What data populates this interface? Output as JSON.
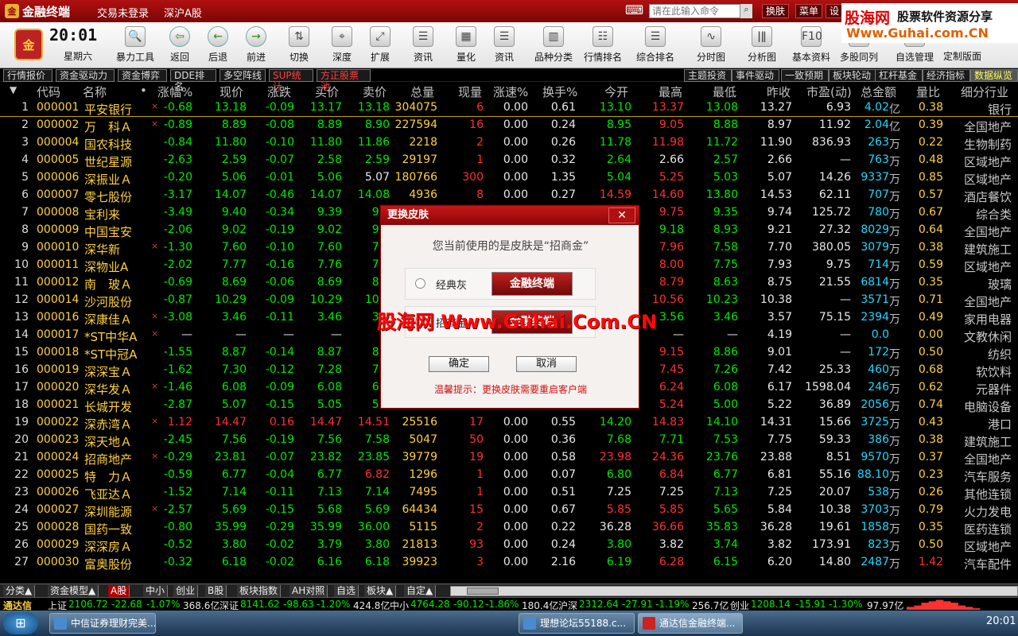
{
  "title": {
    "app": "金融终端",
    "status": "交易未登录",
    "market": "深沪A股",
    "cmd_placeholder": "请在此输入命令",
    "btn_skin": "换肤",
    "btn_menu": "菜单",
    "btn_set": "设"
  },
  "watermark": {
    "top1": "股海网",
    "top2": "股票软件资源分享",
    "top3": "Www.Guhai.com.CN",
    "mid": "股海网 Www.Guhai.Com.CN"
  },
  "clock": {
    "time": "20:01",
    "weekday": "星期六",
    "badge": "金"
  },
  "toolbar": [
    {
      "label": "暴力工具",
      "icon": "magnifier-icon"
    },
    {
      "label": "返回",
      "icon": "back-icon"
    },
    {
      "label": "后退",
      "icon": "left-icon"
    },
    {
      "label": "前进",
      "icon": "right-icon"
    },
    {
      "label": "切换",
      "icon": "switch-icon"
    },
    {
      "label": "深度",
      "icon": "depth-icon"
    },
    {
      "label": "扩展",
      "icon": "expand-icon"
    },
    {
      "label": "资讯",
      "icon": "news-icon"
    },
    {
      "label": "量化",
      "icon": "quant-icon"
    },
    {
      "label": "资讯",
      "icon": "info-icon"
    },
    {
      "label": "品种分类",
      "icon": "category-icon"
    },
    {
      "label": "行情排名",
      "icon": "ranking-icon"
    },
    {
      "label": "综合排名",
      "icon": "list-icon"
    },
    {
      "label": "分时图",
      "icon": "minute-chart-icon"
    },
    {
      "label": "分析图",
      "icon": "kline-icon"
    },
    {
      "label": "基本资料",
      "icon": "f10-icon"
    },
    {
      "label": "多股同列",
      "icon": "multi-stock-icon"
    },
    {
      "label": "自选管理",
      "icon": "favorites-icon"
    },
    {
      "label": "定制版面",
      "icon": "layout-icon"
    }
  ],
  "tabs_left": [
    "行情报价",
    "资金驱动力",
    "资金博弈",
    "DDE排名",
    "多空阵线",
    "SUP统计",
    "方正股票池"
  ],
  "tabs_right": [
    "主题投资",
    "事件驱动",
    "一致预期",
    "板块轮动",
    "杠杆基金",
    "经济指标",
    "数据纵览"
  ],
  "columns": [
    "代码",
    "名称",
    "•",
    "涨幅%",
    "现价",
    "涨跌",
    "买价",
    "卖价",
    "总量",
    "现量",
    "涨速%",
    "换手%",
    "今开",
    "最高",
    "最低",
    "昨收",
    "市盈(动)",
    "总金额",
    "量比",
    "细分行业"
  ],
  "rows": [
    [
      "1",
      "000001",
      "平安银行",
      "×",
      "-0.68",
      "13.18",
      "-0.09",
      "13.17",
      "13.18",
      "304075",
      "6",
      "0.00",
      "0.61",
      "13.10",
      "13.37",
      "13.08",
      "13.27",
      "6.93",
      "4.02",
      "亿",
      "0.38",
      "银行"
    ],
    [
      "2",
      "000002",
      "万　科Ａ",
      "×",
      "-0.89",
      "8.89",
      "-0.08",
      "8.89",
      "8.90",
      "227594",
      "16",
      "0.00",
      "0.24",
      "8.95",
      "9.05",
      "8.88",
      "8.97",
      "11.92",
      "2.04",
      "亿",
      "0.39",
      "全国地产"
    ],
    [
      "3",
      "000004",
      "国农科技",
      "",
      "-0.84",
      "11.80",
      "-0.10",
      "11.80",
      "11.86",
      "2218",
      "2",
      "0.00",
      "0.26",
      "11.78",
      "11.98",
      "11.72",
      "11.90",
      "836.93",
      "263",
      "万",
      "0.22",
      "生物制药"
    ],
    [
      "4",
      "000005",
      "世纪星源",
      "",
      "-2.63",
      "2.59",
      "-0.07",
      "2.58",
      "2.59",
      "29197",
      "1",
      "0.00",
      "0.32",
      "2.64",
      "2.66",
      "2.57",
      "2.66",
      "—",
      "763",
      "万",
      "0.48",
      "区域地产"
    ],
    [
      "5",
      "000006",
      "深振业Ａ",
      "",
      "-0.20",
      "5.06",
      "-0.01",
      "5.06",
      "5.07",
      "180766",
      "300",
      "0.00",
      "1.35",
      "5.04",
      "5.25",
      "5.03",
      "5.07",
      "14.26",
      "9337",
      "万",
      "0.85",
      "区域地产"
    ],
    [
      "6",
      "000007",
      "零七股份",
      "",
      "-3.17",
      "14.07",
      "-0.46",
      "14.07",
      "14.08",
      "4936",
      "8",
      "0.00",
      "0.27",
      "14.59",
      "14.60",
      "13.80",
      "14.53",
      "62.11",
      "707",
      "万",
      "0.57",
      "酒店餐饮"
    ],
    [
      "7",
      "000008",
      "宝利来",
      "",
      "-3.49",
      "9.40",
      "-0.34",
      "9.39",
      "9.4",
      "",
      "",
      "",
      "",
      "",
      "9.75",
      "9.35",
      "9.74",
      "125.72",
      "780",
      "万",
      "0.67",
      "综合类"
    ],
    [
      "8",
      "000009",
      "中国宝安",
      "",
      "-2.06",
      "9.02",
      "-0.19",
      "9.02",
      "9.0",
      "",
      "",
      "",
      "",
      "",
      "9.18",
      "8.93",
      "9.21",
      "27.32",
      "8029",
      "万",
      "0.64",
      "全国地产"
    ],
    [
      "9",
      "000010",
      "深华新",
      "×",
      "-1.30",
      "7.60",
      "-0.10",
      "7.60",
      "7.6",
      "",
      "",
      "",
      "",
      "",
      "7.96",
      "7.58",
      "7.70",
      "380.05",
      "3079",
      "万",
      "0.38",
      "建筑施工"
    ],
    [
      "10",
      "000011",
      "深物业A",
      "",
      "-2.02",
      "7.77",
      "-0.16",
      "7.76",
      "7.7",
      "",
      "",
      "",
      "",
      "",
      "8.00",
      "7.75",
      "7.93",
      "9.75",
      "714",
      "万",
      "0.59",
      "区域地产"
    ],
    [
      "11",
      "000012",
      "南　玻Ａ",
      "",
      "-0.69",
      "8.69",
      "-0.06",
      "8.69",
      "8.7",
      "",
      "",
      "",
      "",
      "",
      "8.79",
      "8.63",
      "8.75",
      "21.55",
      "6814",
      "万",
      "0.35",
      "玻璃"
    ],
    [
      "12",
      "000014",
      "沙河股份",
      "",
      "-0.87",
      "10.29",
      "-0.09",
      "10.29",
      "10.3",
      "",
      "",
      "",
      "",
      "",
      "10.56",
      "10.23",
      "10.38",
      "—",
      "3571",
      "万",
      "0.71",
      "全国地产"
    ],
    [
      "13",
      "000016",
      "深康佳Ａ",
      "×",
      "-3.08",
      "3.46",
      "-0.11",
      "3.46",
      "3.4",
      "",
      "",
      "",
      "",
      "",
      "3.56",
      "3.46",
      "3.57",
      "75.15",
      "2394",
      "万",
      "0.49",
      "家用电器"
    ],
    [
      "14",
      "000017",
      "*ST中华A",
      "×",
      "—",
      "—",
      "—",
      "—",
      "—",
      "",
      "",
      "",
      "",
      "",
      "—",
      "—",
      "4.19",
      "—",
      "0.0",
      "",
      "0.00",
      "文教休闲"
    ],
    [
      "15",
      "000018",
      "*ST中冠A",
      "",
      "-1.55",
      "8.87",
      "-0.14",
      "8.87",
      "8.8",
      "",
      "",
      "",
      "",
      "",
      "9.15",
      "8.86",
      "9.01",
      "—",
      "172",
      "万",
      "0.50",
      "纺织"
    ],
    [
      "16",
      "000019",
      "深深宝Ａ",
      "",
      "-1.62",
      "7.30",
      "-0.12",
      "7.28",
      "7.3",
      "",
      "",
      "",
      "",
      "",
      "7.45",
      "7.26",
      "7.42",
      "25.33",
      "460",
      "万",
      "0.68",
      "软饮料"
    ],
    [
      "17",
      "000020",
      "深华发Ａ",
      "×",
      "-1.46",
      "6.08",
      "-0.09",
      "6.08",
      "6.1",
      "",
      "",
      "",
      "",
      "",
      "6.24",
      "6.08",
      "6.17",
      "1598.04",
      "246",
      "万",
      "0.62",
      "元器件"
    ],
    [
      "18",
      "000021",
      "长城开发",
      "",
      "-2.87",
      "5.07",
      "-0.15",
      "5.05",
      "5.0",
      "",
      "",
      "",
      "",
      "",
      "5.24",
      "5.00",
      "5.22",
      "36.89",
      "2056",
      "万",
      "0.74",
      "电脑设备"
    ],
    [
      "19",
      "000022",
      "深赤湾Ａ",
      "×",
      "1.12",
      "14.47",
      "0.16",
      "14.47",
      "14.51",
      "25516",
      "17",
      "0.00",
      "0.55",
      "14.20",
      "14.83",
      "14.10",
      "14.31",
      "15.66",
      "3725",
      "万",
      "0.43",
      "港口"
    ],
    [
      "20",
      "000023",
      "深天地Ａ",
      "",
      "-2.45",
      "7.56",
      "-0.19",
      "7.56",
      "7.58",
      "5047",
      "50",
      "0.00",
      "0.36",
      "7.68",
      "7.71",
      "7.53",
      "7.75",
      "59.33",
      "386",
      "万",
      "0.38",
      "建筑施工"
    ],
    [
      "21",
      "000024",
      "招商地产",
      "×",
      "-0.29",
      "23.81",
      "-0.07",
      "23.82",
      "23.85",
      "39779",
      "19",
      "0.00",
      "0.58",
      "23.98",
      "24.36",
      "23.76",
      "23.88",
      "8.51",
      "9570",
      "万",
      "0.37",
      "全国地产"
    ],
    [
      "22",
      "000025",
      "特　力Ａ",
      "",
      "-0.59",
      "6.77",
      "-0.04",
      "6.77",
      "6.82",
      "1296",
      "1",
      "0.00",
      "0.07",
      "6.80",
      "6.84",
      "6.77",
      "6.81",
      "55.16",
      "88.10",
      "万",
      "0.23",
      "汽车服务"
    ],
    [
      "23",
      "000026",
      "飞亚达Ａ",
      "",
      "-1.52",
      "7.14",
      "-0.11",
      "7.13",
      "7.14",
      "7495",
      "1",
      "0.00",
      "0.51",
      "7.25",
      "7.25",
      "7.13",
      "7.25",
      "20.07",
      "538",
      "万",
      "0.26",
      "其他连锁"
    ],
    [
      "24",
      "000027",
      "深圳能源",
      "×",
      "-2.57",
      "5.69",
      "-0.15",
      "5.68",
      "5.69",
      "64434",
      "15",
      "0.00",
      "0.67",
      "5.85",
      "5.85",
      "5.65",
      "5.84",
      "10.38",
      "3703",
      "万",
      "0.79",
      "火力发电"
    ],
    [
      "25",
      "000028",
      "国药一致",
      "",
      "-0.80",
      "35.99",
      "-0.29",
      "35.99",
      "36.00",
      "5115",
      "2",
      "0.00",
      "0.22",
      "36.28",
      "36.66",
      "35.83",
      "36.28",
      "19.61",
      "1858",
      "万",
      "0.35",
      "医药连锁"
    ],
    [
      "26",
      "000029",
      "深深房Ａ",
      "",
      "-0.52",
      "3.80",
      "-0.02",
      "3.79",
      "3.80",
      "21813",
      "93",
      "0.00",
      "0.24",
      "3.80",
      "3.82",
      "3.74",
      "3.82",
      "173.91",
      "823",
      "万",
      "0.50",
      "区域地产"
    ],
    [
      "27",
      "000030",
      "富奥股份",
      "",
      "-0.32",
      "6.18",
      "-0.02",
      "6.16",
      "6.18",
      "39923",
      "3",
      "0.00",
      "2.16",
      "6.19",
      "6.28",
      "6.15",
      "6.20",
      "14.80",
      "2487",
      "万",
      "1.42",
      "汽车配件"
    ]
  ],
  "dialog": {
    "title": "更换皮肤",
    "close": "✕",
    "message": "您当前使用的是皮肤是“招商金”",
    "opt1": "经典灰",
    "opt2": "招商金",
    "skin_logo": "金融终端",
    "ok": "确定",
    "cancel": "取消",
    "tip": "温馨提示：更换皮肤需要重启客户端"
  },
  "bottom_tabs": [
    "分类▲",
    "资金模型▲",
    "A股",
    "中小",
    "创业",
    "B股",
    "板块指数",
    "AH对照",
    "自选",
    "板块▲",
    "自定▲"
  ],
  "ticker": {
    "brand": "通达信",
    "sh_label": "上证",
    "sh_val": "2106.72",
    "sh_chg": "-22.68",
    "sh_pct": "-1.07%",
    "sh_amt": "368.6亿",
    "sz_label": "深证",
    "sz_val": "8141.62",
    "sz_chg": "-98.63",
    "sz_pct": "-1.20%",
    "sz_amt": "424.8亿",
    "zx_label": "中小",
    "zx_val": "4764.28",
    "zx_chg": "-90.12",
    "zx_pct": "-1.86%",
    "zx_amt": "180.4亿",
    "hs_label": "沪深",
    "hs_val": "2312.64",
    "hs_chg": "-27.91",
    "hs_pct": "-1.19%",
    "hs_amt": "256.7亿",
    "cy_label": "创业",
    "cy_val": "1208.14",
    "cy_chg": "-15.91",
    "cy_pct": "-1.30%",
    "cy_amt": "97.97亿"
  },
  "taskbar": {
    "start": "⊞",
    "tasks": [
      "中信证券理财完美...",
      "理想论坛55188.c...",
      "通达信金融终端..."
    ],
    "time": "20:01"
  }
}
